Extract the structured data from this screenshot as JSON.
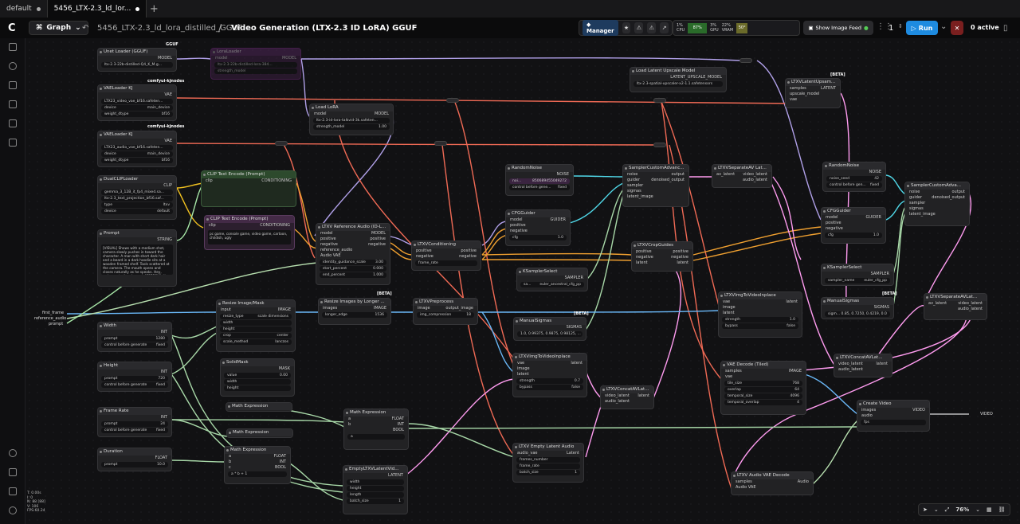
{
  "tabs": [
    {
      "label": "default"
    },
    {
      "label": "5456_LTX-2.3_ld_lor..."
    }
  ],
  "toolbar": {
    "graph_label": "Graph",
    "breadcrumb_parent": "5456_LTX-2.3_ld_lora_distilled_GGUF",
    "breadcrumb_sep": "/",
    "breadcrumb_current": "Video Generation (LTX-2.3 ID LoRA) GGUF",
    "manager_label": "Manager",
    "cpu_label": "CPU",
    "cpu_value": "1%",
    "ram_label": "RAM",
    "ram_value": "87%",
    "gpu_label": "GPU",
    "gpu_value": "3%",
    "vram_label": "VRAM",
    "vram_value": "22%",
    "temp_label": "Temp",
    "temp_value": "50°",
    "feed_label": "Show Image Feed",
    "queue_count": "1",
    "run_label": "Run",
    "active_label": "0 active"
  },
  "stats": [
    "T: 0.00s",
    "I: 0",
    "N: 88 [88]",
    "V: 106",
    "FPS:60.24"
  ],
  "zoom": "76%",
  "io": {
    "first_frame": "first_frame",
    "reference_audio": "reference_audio",
    "prompt": "prompt",
    "video_out": "VIDEO"
  },
  "nodes": {
    "unet": {
      "title": "Unet Loader (GGUF)",
      "tag": "GGUF",
      "out": "MODEL",
      "w1": "ltx-2.3-22b-distilled-Q4_K_M.g..."
    },
    "lora_bypass": {
      "title": "LoraLoader",
      "in": "model",
      "out": "MODEL",
      "w1": "ltx-2.3-22b-distilled-lora-384...",
      "w2": "strength_model"
    },
    "vae1": {
      "title": "VAELoader KJ",
      "tag": "comfyui-kjnodes",
      "out": "VAE",
      "w1": "LTX23_video_vae_bf16.safeten...",
      "w2l": "device",
      "w2v": "main_device",
      "w3l": "weight_dtype",
      "w3v": "bf16"
    },
    "vae2": {
      "title": "VAELoader KJ",
      "tag": "comfyui-kjnodes",
      "out": "VAE",
      "w1": "LTX23_audio_vae_bf16.safeten...",
      "w2l": "device",
      "w2v": "main_device",
      "w3l": "weight_dtype",
      "w3v": "bf16"
    },
    "dualclip": {
      "title": "DualCLIPLoader",
      "out": "CLIP",
      "w1": "gemma_3_12B_it_fp4_mixed.sa...",
      "w2": "ltx-2.3_text_projection_bf16.saf...",
      "w3l": "type",
      "w3v": "ltxv",
      "w4l": "device",
      "w4v": "default"
    },
    "prompt": {
      "title": "Prompt",
      "out": "STRING",
      "text": "[VISUAL] Shows with a medium shot, camera slowly pushes in toward the character. A man with short dark hair and a beard in a dark hoodie sits at a wooden framed shelf. Tools scattered at the camera. The mouth opens and closes naturally as he speaks. Hey, welcome to the channel. [SPEECH]: Hey, what is up? He thinks of this idea? [AUDIO]: Voice is calm and low, moderate volume, close to mic environment."
    },
    "clip_pos": {
      "title": "CLIP Text Encode (Prompt)",
      "in": "clip",
      "out": "CONDITIONING"
    },
    "clip_neg": {
      "title": "CLIP Text Encode (Prompt)",
      "in": "clip",
      "out": "CONDITIONING",
      "text": "pc game, console game, video game, cartoon, childish, ugly"
    },
    "load_lora": {
      "title": "Load LoRA",
      "in": "model",
      "out": "MODEL",
      "w1": "ltx-2.3-id-lora-talkvid-3k.safeten...",
      "w2l": "strength_model",
      "w2v": "1.00"
    },
    "ref_audio": {
      "title": "LTXV Reference Audio (ID-L...",
      "ins": [
        "model",
        "positive",
        "negative",
        "reference_audio",
        "Audio VAE"
      ],
      "outs": [
        "MODEL",
        "positive",
        "negative"
      ],
      "w1l": "identity_guidance_scale",
      "w1v": "3.00",
      "w2l": "start_percent",
      "w2v": "0.000",
      "w3l": "end_percent",
      "w3v": "1.000"
    },
    "cond": {
      "title": "LTXVConditioning",
      "ins": [
        "positive",
        "negative"
      ],
      "outs": [
        "positive",
        "negative"
      ],
      "w1": "frame_rate"
    },
    "noise1": {
      "title": "RandomNoise",
      "out": "NOISE",
      "w1l": "noi...",
      "w1v": "850689455049272",
      "w2l": "control before gene...",
      "w2v": "fixed"
    },
    "cfg1": {
      "title": "CFGGuider",
      "ins": [
        "model",
        "positive",
        "negative"
      ],
      "out": "GUIDER",
      "w1l": "cfg",
      "w1v": "1.0"
    },
    "ksampler1": {
      "title": "KSamplerSelect",
      "out": "SAMPLER",
      "w1l": "sa...",
      "w1v": "euler_ancestral_cfg_pp"
    },
    "sigmas1": {
      "title": "ManualSigmas",
      "tag": "[BETA]",
      "out": "SIGMAS",
      "w1": "1.0, 0.99375, 0.9875, 0.98125, ..."
    },
    "sca1": {
      "title": "SamplerCustomAdvanc...",
      "ins": [
        "noise",
        "guider",
        "sampler",
        "sigmas",
        "latent_image"
      ],
      "outs": [
        "output",
        "denoised_output"
      ]
    },
    "separate1": {
      "title": "LTXVSeparateAV Lat...",
      "in": "av_latent",
      "outs": [
        "video_latent",
        "audio_latent"
      ]
    },
    "crop": {
      "title": "LTXVCropGuides",
      "ins": [
        "positive",
        "negative",
        "latent"
      ],
      "outs": [
        "positive",
        "negative",
        "latent"
      ]
    },
    "latent_upsample_loader": {
      "title": "Load Latent Upscale Model",
      "out": "LATENT_UPSCALE_MODEL",
      "w1": "ltx-2.3-spatial-upscaler-x2-1.1.safetensors"
    },
    "latent_upsample": {
      "title": "LTXVLatentUpsam...",
      "tag": "[BETA]",
      "ins": [
        "samples",
        "upscale_model",
        "vae"
      ],
      "out": "LATENT"
    },
    "noise2": {
      "title": "RandomNoise",
      "out": "NOISE",
      "w1l": "noise_seed",
      "w1v": "42",
      "w2l": "control before gen...",
      "w2v": "fixed"
    },
    "cfg2": {
      "title": "CFGGuider",
      "ins": [
        "model",
        "positive",
        "negative"
      ],
      "out": "GUIDER",
      "w1l": "cfg",
      "w1v": "1.0"
    },
    "ksampler2": {
      "title": "KSamplerSelect",
      "out": "SAMPLER",
      "w1l": "sampler_name",
      "w1v": "euler_cfg_pp"
    },
    "sigmas2": {
      "title": "ManualSigmas",
      "tag": "[BETA]",
      "out": "SIGMAS",
      "w1": "sigm... 0.85, 0.7250, 0.4219, 0.0"
    },
    "sca2": {
      "title": "SamplerCustomAdva...",
      "ins": [
        "noise",
        "guider",
        "sampler",
        "sigmas",
        "latent_image"
      ],
      "outs": [
        "output",
        "denoised_output"
      ]
    },
    "separate2": {
      "title": "LTXVSeparateAVLat...",
      "in": "av_latent",
      "outs": [
        "video_latent",
        "audio_latent"
      ]
    },
    "concat2": {
      "title": "LTXVConcatAVLat...",
      "ins": [
        "video_latent",
        "audio_latent"
      ],
      "out": "latent"
    },
    "imgtovid2": {
      "title": "LTXVImgToVideoInplace",
      "ins": [
        "vae",
        "image",
        "latent"
      ],
      "out": "latent",
      "w1l": "strength",
      "w1v": "1.0",
      "w2l": "bypass",
      "w2v": "false"
    },
    "vae_decode_tiled": {
      "title": "VAE Decode (Tiled)",
      "ins": [
        "samples",
        "vae"
      ],
      "out": "IMAGE",
      "w1l": "tile_size",
      "w1v": "768",
      "w2l": "overlap",
      "w2v": "64",
      "w3l": "temporal_size",
      "w3v": "4096",
      "w4l": "temporal_overlap",
      "w4v": "4"
    },
    "audio_decode": {
      "title": "LTXV Audio VAE Decode",
      "ins": [
        "samples",
        "Audio VAE"
      ],
      "out": "Audio"
    },
    "create_video": {
      "title": "Create Video",
      "ins": [
        "images",
        "audio",
        "fps"
      ],
      "out": "VIDEO"
    },
    "width": {
      "title": "Width",
      "out": "INT",
      "w1l": "prompt",
      "w1v": "1280",
      "w2l": "control before generate",
      "w2v": "fixed"
    },
    "height": {
      "title": "Height",
      "out": "INT",
      "w1l": "prompt",
      "w1v": "720",
      "w2l": "control before generate",
      "w2v": "fixed"
    },
    "framerate": {
      "title": "Frame Rate",
      "out": "INT",
      "w1l": "prompt",
      "w1v": "24",
      "w2l": "control before generate",
      "w2v": "fixed"
    },
    "duration": {
      "title": "Duration",
      "out": "FLOAT",
      "w1l": "prompt",
      "w1v": "10.0"
    },
    "resize": {
      "title": "Resize Image/Mask",
      "in": "input",
      "out": "IMAGE",
      "w1l": "resize_type",
      "w1v": "scale dimensions",
      "w2": "width",
      "w3": "height",
      "w4l": "crop",
      "w4v": "center",
      "w5l": "scale_method",
      "w5v": "lanczos"
    },
    "solidmask": {
      "title": "SolidMask",
      "out": "MASK",
      "w1l": "value",
      "w1v": "0.00",
      "w2": "width",
      "w3": "height"
    },
    "math1": {
      "title": "Math Expression"
    },
    "math2": {
      "title": "Math Expression"
    },
    "math3": {
      "title": "Math Expression",
      "ins": [
        "a",
        "b",
        "c"
      ],
      "outs": [
        "FLOAT",
        "INT",
        "BOOL"
      ],
      "expr": "a * b + 1"
    },
    "math4": {
      "title": "Math Expression",
      "ins": [
        "a",
        "b"
      ],
      "outs": [
        "FLOAT",
        "INT",
        "BOOL"
      ],
      "expr": "a"
    },
    "resize_longer": {
      "title": "Resize Images by Longer ...",
      "tag": "[BETA]",
      "in": "images",
      "out": "IMAGE",
      "w1l": "longer_edge",
      "w1v": "1536"
    },
    "preprocess": {
      "title": "LTXVPreprocess",
      "in": "image",
      "out": "output_image",
      "w1l": "img_compression",
      "w1v": "18"
    },
    "imgtovid1": {
      "title": "LTXVImgToVideoInplace",
      "ins": [
        "vae",
        "image",
        "latent"
      ],
      "out": "latent",
      "w1l": "strength",
      "w1v": "0.7",
      "w2l": "bypass",
      "w2v": "false"
    },
    "concat1": {
      "title": "LTXVConcatAVLat...",
      "ins": [
        "video_latent",
        "audio_latent"
      ],
      "out": "latent"
    },
    "empty_latent": {
      "title": "EmptyLTXVLatentVid...",
      "out": "LATENT",
      "w1": "width",
      "w2": "height",
      "w3": "length",
      "w4l": "batch_size",
      "w4v": "1"
    },
    "empty_audio": {
      "title": "LTXV Empty Latent Audio",
      "ins": [
        "audio_vae"
      ],
      "out": "Latent",
      "w1": "frames_number",
      "w2": "frame_rate",
      "w3l": "batch_size",
      "w3v": "1"
    }
  }
}
